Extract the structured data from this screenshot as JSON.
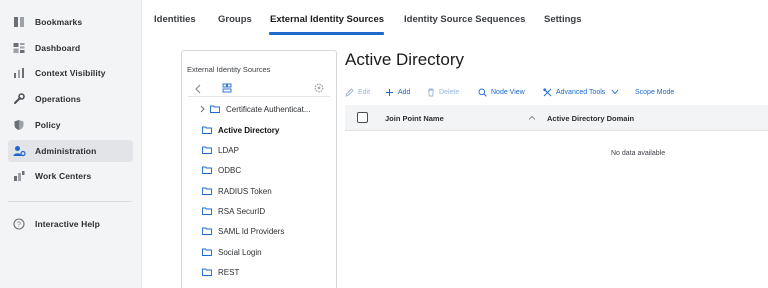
{
  "leftnav": {
    "items": [
      {
        "label": "Bookmarks",
        "icon": "bookmark-icon"
      },
      {
        "label": "Dashboard",
        "icon": "dashboard-icon"
      },
      {
        "label": "Context Visibility",
        "icon": "context-visibility-icon"
      },
      {
        "label": "Operations",
        "icon": "wrench-icon"
      },
      {
        "label": "Policy",
        "icon": "shield-icon"
      },
      {
        "label": "Administration",
        "icon": "admin-user-gear-icon"
      },
      {
        "label": "Work Centers",
        "icon": "work-centers-icon"
      }
    ],
    "help": {
      "label": "Interactive Help",
      "icon": "help-circle-icon"
    }
  },
  "tabs": [
    {
      "label": "Identities"
    },
    {
      "label": "Groups"
    },
    {
      "label": "External Identity Sources"
    },
    {
      "label": "Identity Source Sequences"
    },
    {
      "label": "Settings"
    }
  ],
  "tree": {
    "title": "External Identity Sources",
    "items": [
      {
        "label": "Certificate Authenticat..."
      },
      {
        "label": "Active Directory"
      },
      {
        "label": "LDAP"
      },
      {
        "label": "ODBC"
      },
      {
        "label": "RADIUS Token"
      },
      {
        "label": "RSA SecurID"
      },
      {
        "label": "SAML Id Providers"
      },
      {
        "label": "Social Login"
      },
      {
        "label": "REST"
      }
    ]
  },
  "main": {
    "title": "Active Directory",
    "toolbar": {
      "edit": "Edit",
      "add": "Add",
      "delete": "Delete",
      "node_view": "Node View",
      "advanced_tools": "Advanced Tools",
      "scope_mode": "Scope Mode"
    },
    "table": {
      "columns": [
        "Join Point Name",
        "Active Directory Domain"
      ],
      "empty_text": "No data available"
    }
  },
  "colors": {
    "accent": "#1d69cc",
    "sidebar_bg": "#f3f4f6",
    "active_nav": "#e2e4e8"
  }
}
